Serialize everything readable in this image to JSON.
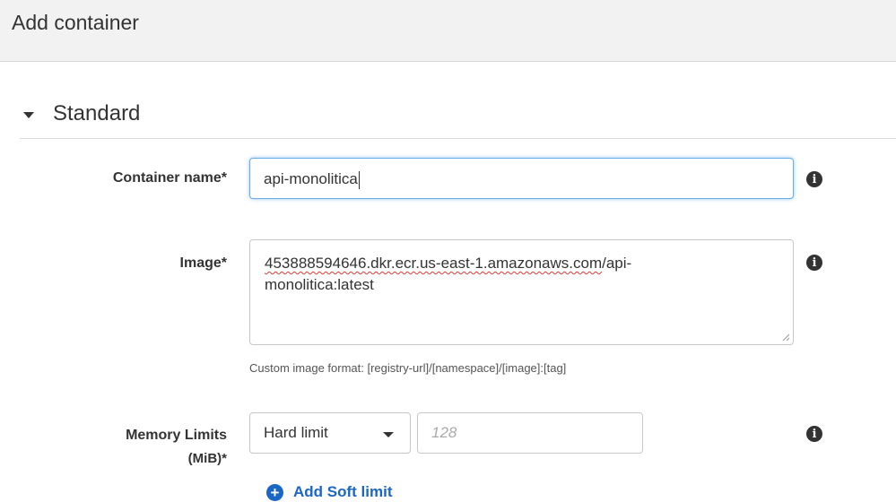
{
  "modal": {
    "title": "Add container"
  },
  "section": {
    "title": "Standard"
  },
  "fields": {
    "container_name": {
      "label": "Container name*",
      "value": "api-monolitica"
    },
    "image": {
      "label": "Image*",
      "value_line1_a": "453888594646.dkr.ecr.us-east-1.amazonaws.com",
      "value_line1_b": "/api-",
      "value_line2": "monolitica:latest",
      "help": "Custom image format: [registry-url]/[namespace]/[image]:[tag]"
    },
    "memory_limits": {
      "label_line1": "Memory Limits",
      "label_line2": "(MiB)*",
      "limit_type": "Hard limit",
      "placeholder": "128",
      "add_link": "Add Soft limit"
    }
  },
  "icons": {
    "info": "info-icon",
    "add": "plus-circle-icon",
    "caret": "caret-down-icon"
  },
  "colors": {
    "header_bg": "#f2f2f2",
    "link": "#1a66c4",
    "focus": "#66afe9"
  }
}
